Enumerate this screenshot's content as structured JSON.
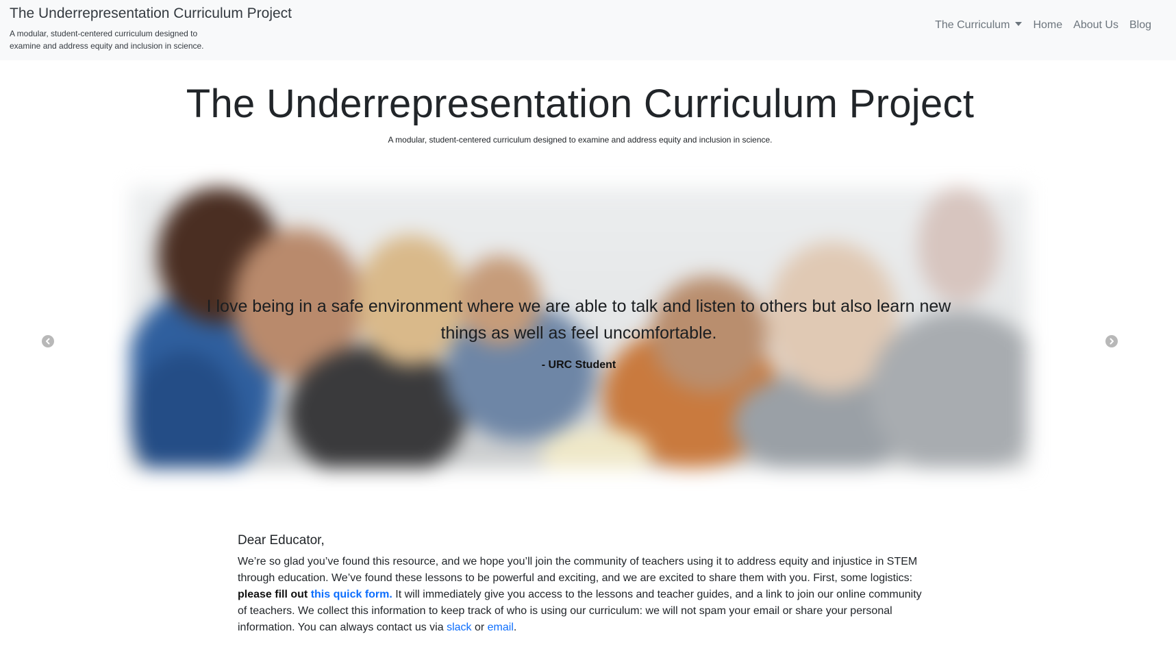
{
  "navbar": {
    "brand_title": "The Underrepresentation Curriculum Project",
    "brand_tagline": "A modular, student-centered curriculum designed to examine and address equity and inclusion in science.",
    "links": {
      "curriculum": "The Curriculum",
      "home": "Home",
      "about": "About Us",
      "blog": "Blog"
    }
  },
  "hero": {
    "title": "The Underrepresentation Curriculum Project",
    "tagline": "A modular, student-centered curriculum designed to examine and address equity and inclusion in science."
  },
  "carousel": {
    "quote": "I love being in a safe environment where we are able to talk and listen to others but also learn new things as well as feel uncomfortable.",
    "attribution": "- URC Student",
    "prev_icon": "chevron-left-icon",
    "next_icon": "chevron-right-icon"
  },
  "letter": {
    "greeting": "Dear Educator,",
    "p1": "We’re so glad you’ve found this resource, and we hope you’ll join the community of teachers using it to address equity and injustice in STEM through education. We’ve found these lessons to be powerful and exciting, and we are excited to share them with you. First, some logistics: ",
    "p1_bold": "please fill out ",
    "form_link": "this quick form.",
    "p2": " It will immediately give you access to the lessons and teacher guides, and a link to join our online community of teachers. We collect this information to keep track of who is using our curriculum: we will not spam your email or share your personal information. You can always contact us via ",
    "slack_link": "slack",
    "or_text": " or ",
    "email_link": "email",
    "end": "."
  },
  "colors": {
    "navbar_bg": "#f8f9fa",
    "link": "#0d6efd",
    "nav_text": "#6c757d"
  }
}
